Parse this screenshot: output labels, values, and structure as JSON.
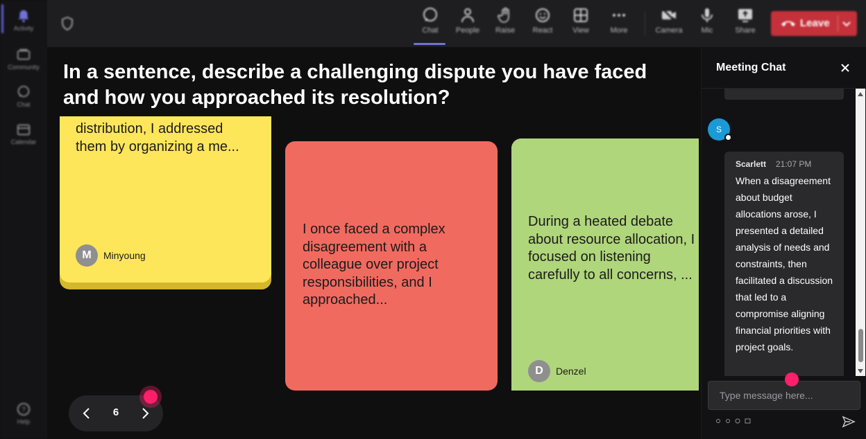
{
  "rail": {
    "items": [
      {
        "label": "Activity",
        "icon": "bell-icon"
      },
      {
        "label": "Community",
        "icon": "community-icon"
      },
      {
        "label": "Chat",
        "icon": "chat-bubble-icon"
      },
      {
        "label": "Calendar",
        "icon": "calendar-icon"
      },
      {
        "label": "Help",
        "icon": "help-icon"
      }
    ]
  },
  "toolbar": {
    "chat_label": "Chat",
    "people_label": "People",
    "raise_label": "Raise",
    "react_label": "React",
    "view_label": "View",
    "more_label": "More",
    "camera_label": "Camera",
    "mic_label": "Mic",
    "share_label": "Share",
    "leave_label": "Leave"
  },
  "stage": {
    "question": "In a sentence, describe a challenging dispute you have faced and how you approached its resolution?",
    "cards": [
      {
        "color": "#fde65a",
        "text": "distribution, I addressed them by organizing a me...",
        "author": "Minyoung",
        "initial": "M"
      },
      {
        "color": "#f16a60",
        "text": "I once faced a complex disagreement with a colleague over project responsibilities, and I approached...",
        "author": "",
        "initial": ""
      },
      {
        "color": "#b0d67b",
        "text": "During a heated debate about resource allocation, I focused on listening carefully to all concerns, ...",
        "author": "Denzel",
        "initial": "D"
      }
    ],
    "pager": {
      "page": "6"
    }
  },
  "chat": {
    "title": "Meeting Chat",
    "message": {
      "sender": "Scarlett",
      "initial": "S",
      "time": "21:07 PM",
      "body": "When a disagreement about budget allocations arose, I presented a detailed analysis of needs and constraints, then facilitated a discussion that led to a compromise aligning financial priorities with project goals."
    },
    "input_placeholder": "Type message here..."
  },
  "colors": {
    "accent": "#5b5fc7",
    "leave": "#c4313b",
    "cursor": "#ff1f6b",
    "chat_avatar": "#1a9ad6"
  }
}
